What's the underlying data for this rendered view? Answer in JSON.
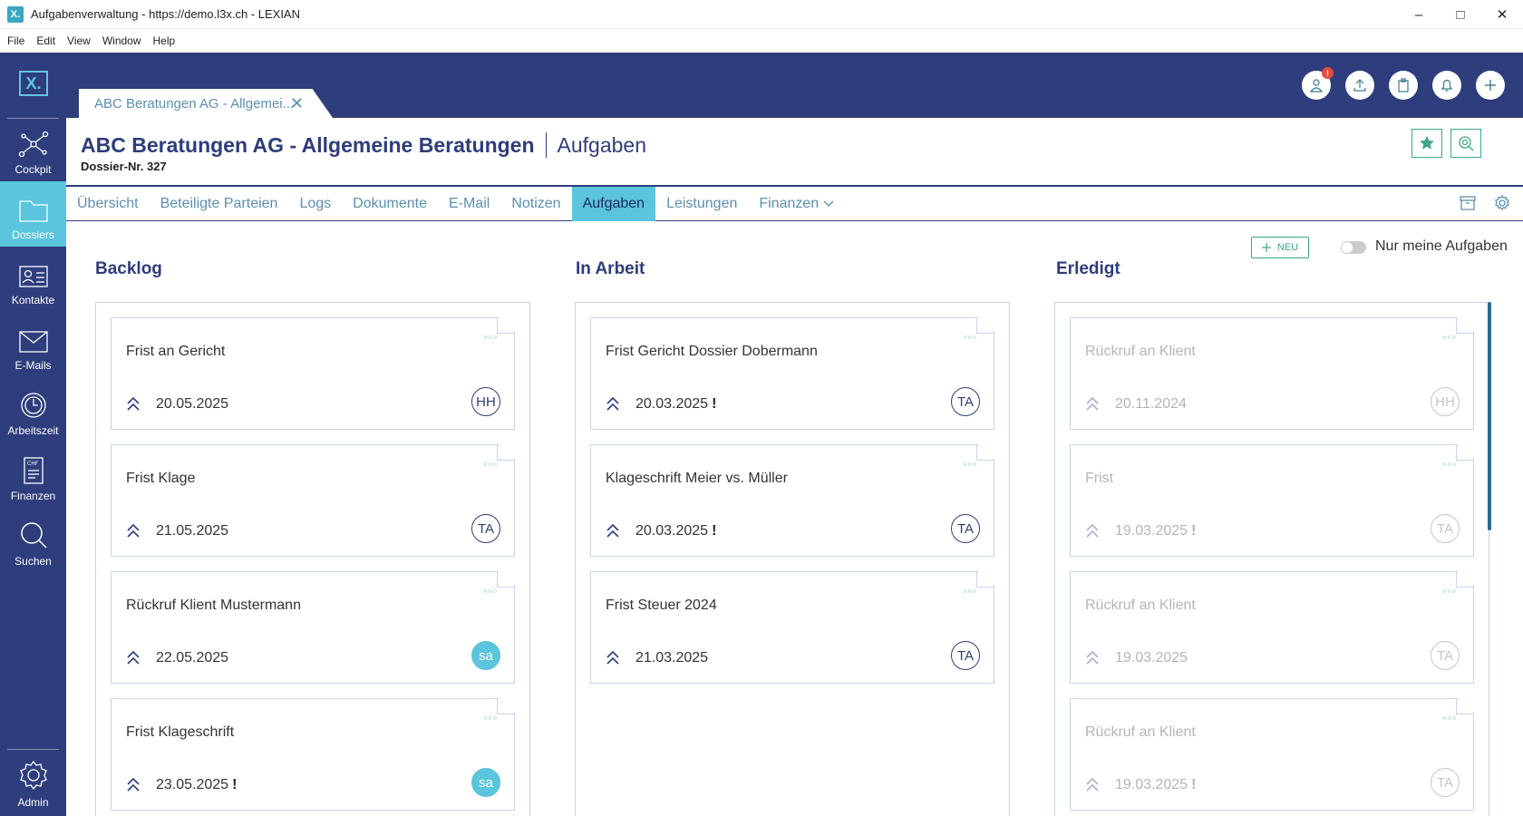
{
  "window": {
    "title": "Aufgabenverwaltung - https://demo.l3x.ch - LEXIAN",
    "app_icon": "X."
  },
  "menu": [
    "File",
    "Edit",
    "View",
    "Window",
    "Help"
  ],
  "sidebar": {
    "logo": "X.",
    "items": [
      {
        "label": "Cockpit",
        "icon": "network-icon"
      },
      {
        "label": "Dossiers",
        "icon": "folder-icon"
      },
      {
        "label": "Kontakte",
        "icon": "contact-card-icon"
      },
      {
        "label": "E-Mails",
        "icon": "envelope-icon"
      },
      {
        "label": "Arbeitszeit",
        "icon": "clock-icon"
      },
      {
        "label": "Finanzen",
        "icon": "invoice-icon",
        "icon_text": "CHF"
      },
      {
        "label": "Suchen",
        "icon": "search-icon"
      }
    ],
    "admin": {
      "label": "Admin",
      "icon": "gear-icon"
    }
  },
  "doc_tab": {
    "label": "ABC Beratungen AG - Allgemei..."
  },
  "top_icons": {
    "badge": "!"
  },
  "dossier": {
    "title": "ABC Beratungen AG - Allgemeine Beratungen",
    "section": "Aufgaben",
    "nr": "Dossier-Nr. 327"
  },
  "tabs": [
    "Übersicht",
    "Beteiligte Parteien",
    "Logs",
    "Dokumente",
    "E-Mail",
    "Notizen",
    "Aufgaben",
    "Leistungen",
    "Finanzen"
  ],
  "active_tab": "Aufgaben",
  "board": {
    "new_label": "NEU",
    "toggle_label": "Nur meine Aufgaben",
    "columns": [
      {
        "title": "Backlog",
        "cards": [
          {
            "title": "Frist an Gericht",
            "date": "20.05.2025",
            "excl": "",
            "avatar": "HH",
            "filled": false
          },
          {
            "title": "Frist Klage",
            "date": "21.05.2025",
            "excl": "",
            "avatar": "TA",
            "filled": false
          },
          {
            "title": "Rückruf Klient Mustermann",
            "date": "22.05.2025",
            "excl": "",
            "avatar": "sa",
            "filled": true
          },
          {
            "title": "Frist Klageschrift",
            "date": "23.05.2025",
            "excl": "!",
            "avatar": "sa",
            "filled": true
          }
        ]
      },
      {
        "title": "In Arbeit",
        "cards": [
          {
            "title": "Frist Gericht Dossier Dobermann",
            "date": "20.03.2025",
            "excl": "!",
            "avatar": "TA",
            "filled": false
          },
          {
            "title": "Klageschrift Meier vs. Müller",
            "date": "20.03.2025",
            "excl": "!",
            "avatar": "TA",
            "filled": false
          },
          {
            "title": "Frist Steuer 2024",
            "date": "21.03.2025",
            "excl": "",
            "avatar": "TA",
            "filled": false
          }
        ]
      },
      {
        "title": "Erledigt",
        "cards": [
          {
            "title": "Rückruf an Klient",
            "date": "20.11.2024",
            "excl": "",
            "avatar": "HH",
            "filled": false
          },
          {
            "title": "Frist",
            "date": "19.03.2025",
            "excl": "!",
            "avatar": "TA",
            "filled": false
          },
          {
            "title": "Rückruf an Klient",
            "date": "19.03.2025",
            "excl": "",
            "avatar": "TA",
            "filled": false
          },
          {
            "title": "Rückruf an Klient",
            "date": "19.03.2025",
            "excl": "!",
            "avatar": "TA",
            "filled": false
          }
        ]
      }
    ]
  },
  "colors": {
    "navy": "#2e3d7c",
    "cyan": "#5ac5dc",
    "green": "#3ea58a",
    "link": "#5b8fb0"
  }
}
